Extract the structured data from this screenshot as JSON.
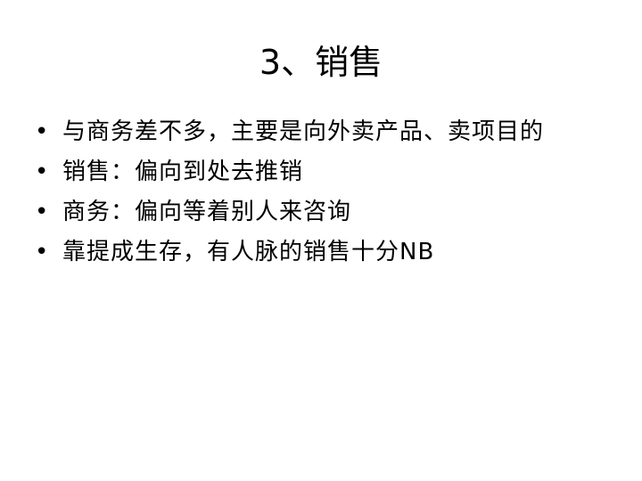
{
  "slide": {
    "title": "3、销售",
    "bullet_glyph": "•",
    "bullets": [
      "与商务差不多，主要是向外卖产品、卖项目的",
      "销售：偏向到处去推销",
      "商务：偏向等着别人来咨询",
      "靠提成生存，有人脉的销售十分NB"
    ]
  }
}
